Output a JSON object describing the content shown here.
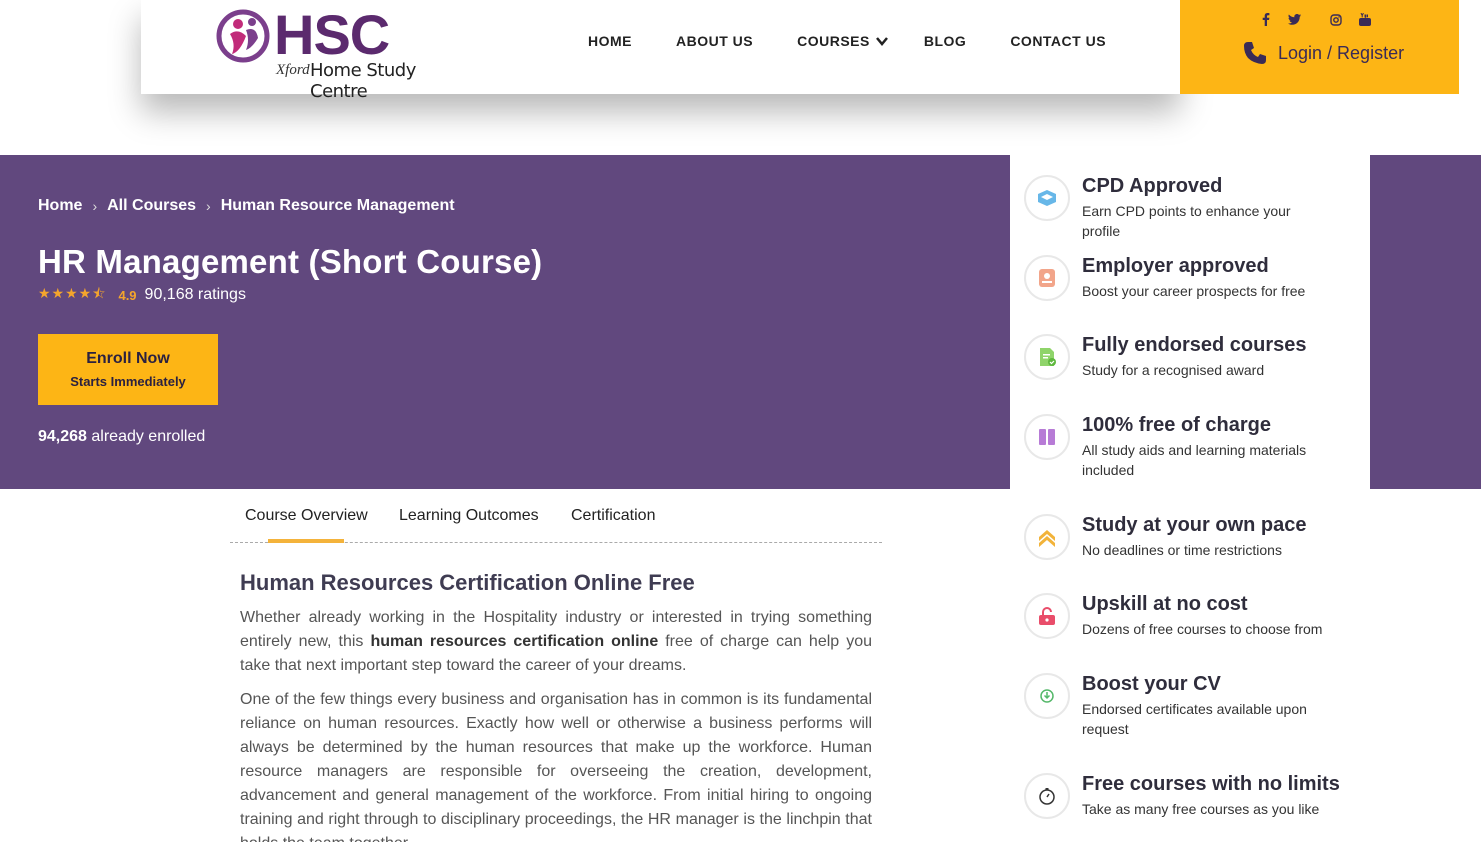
{
  "header": {
    "logo": {
      "text": "HSC",
      "sub_script": "Xford",
      "sub": "Home Study Centre"
    },
    "nav": [
      {
        "label": "HOME"
      },
      {
        "label": "ABOUT US"
      },
      {
        "label": "COURSES"
      },
      {
        "label": "BLOG"
      },
      {
        "label": "CONTACT US"
      }
    ],
    "socials": [
      "facebook-icon",
      "twitter-icon",
      "instagram-icon",
      "youtube-icon"
    ],
    "login_label": "Login / Register"
  },
  "hero": {
    "breadcrumb": [
      "Home",
      "All Courses",
      "Human Resource Management"
    ],
    "title": "HR Management (Short Course)",
    "stars": "★★★★⯪",
    "rating_value": "4.9",
    "rating_count": "90,168 ratings",
    "enroll_label": "Enroll Now",
    "enroll_sub": "Starts Immediately",
    "enrolled_count": "94,268",
    "enrolled_suffix": " already enrolled"
  },
  "tabs": [
    "Course Overview",
    "Learning Outcomes",
    "Certification"
  ],
  "content": {
    "heading": "Human Resources Certification Online Free",
    "p1_a": "Whether already working in the Hospitality industry or interested in trying something entirely new, this ",
    "p1_b": "human resources certification online",
    "p1_c": " free of charge can help you take that next important step toward the career of your dreams.",
    "p2": "One of the few things every business and organisation has in common is its fundamental reliance on human resources.  Exactly how well or otherwise a business performs will always be determined by the human resources that make up the workforce.  Human resource managers are responsible for overseeing the creation, development, advancement and general management of the workforce.  From initial hiring to ongoing training and right through to disciplinary proceedings, the HR manager is the linchpin that holds the team together."
  },
  "sidebar": [
    {
      "title": "CPD Approved",
      "desc": "Earn CPD points to enhance your profile",
      "icon": "graduation-cap-icon"
    },
    {
      "title": "Employer approved",
      "desc": "Boost your career prospects for free",
      "icon": "employee-badge-icon"
    },
    {
      "title": "Fully endorsed courses",
      "desc": "Study for a recognised award",
      "icon": "certificate-icon"
    },
    {
      "title": "100% free of charge",
      "desc": "All study aids and learning materials included",
      "icon": "books-icon"
    },
    {
      "title": "Study at your own pace",
      "desc": "No deadlines or time restrictions",
      "icon": "chevrons-up-icon"
    },
    {
      "title": "Upskill at no cost",
      "desc": "Dozens of free courses to choose from",
      "icon": "unlock-icon"
    },
    {
      "title": "Boost your CV",
      "desc": "Endorsed certificates available upon request",
      "icon": "cv-badge-icon"
    },
    {
      "title": "Free courses with no limits",
      "desc": "Take as many free courses as you like",
      "icon": "stopwatch-icon"
    }
  ],
  "colors": {
    "purple": "#61487e",
    "yellow": "#fdb515",
    "logo": "#5b2a6e"
  }
}
